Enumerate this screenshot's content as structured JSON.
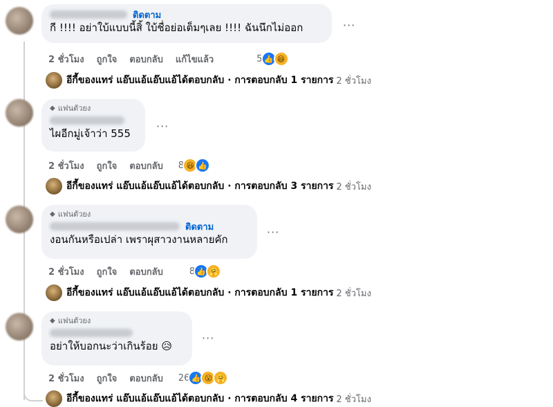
{
  "comments": [
    {
      "badge": "",
      "follow": "ติดตาม",
      "text": "กี !!!! อย่าใบ้แบบนี้สิ้ ใบ้ชื่อย่อเต็มๆเลย !!!! ฉันนึกไม่ออก",
      "actions": {
        "time": "2 ชั่วโมง",
        "like": "ถูกใจ",
        "reply": "ตอบกลับ",
        "edited": "แก้ไขแล้ว"
      },
      "reaction_count": "5",
      "reply_summary": {
        "name": "อีกี้ของแทร่ แอ๊บแอ้แอ๊บแอ้",
        "text": " ได้ตอบกลับ · การตอบกลับ 1 รายการ",
        "time": "2 ชั่วโมง"
      }
    },
    {
      "badge": "แฟนตัวยง",
      "text": "ไผอีกมู่เจ้าว่า 555",
      "actions": {
        "time": "2 ชั่วโมง",
        "like": "ถูกใจ",
        "reply": "ตอบกลับ"
      },
      "reaction_count": "8",
      "reply_summary": {
        "name": "อีกี้ของแทร่ แอ๊บแอ้แอ๊บแอ้",
        "text": " ได้ตอบกลับ · การตอบกลับ 3 รายการ",
        "time": "2 ชั่วโมง"
      }
    },
    {
      "badge": "แฟนตัวยง",
      "follow": "ติดตาม",
      "text": "งอนกันหรือเปล่า เพราผุสาวงานหลายคัก",
      "actions": {
        "time": "2 ชั่วโมง",
        "like": "ถูกใจ",
        "reply": "ตอบกลับ"
      },
      "reaction_count": "8",
      "reply_summary": {
        "name": "อีกี้ของแทร่ แอ๊บแอ้แอ๊บแอ้",
        "text": " ได้ตอบกลับ · การตอบกลับ 1 รายการ",
        "time": "2 ชั่วโมง"
      }
    },
    {
      "badge": "แฟนตัวยง",
      "text": "อย่าให้บอกนะว่าเกินร้อย",
      "actions": {
        "time": "2 ชั่วโมง",
        "like": "ถูกใจ",
        "reply": "ตอบกลับ"
      },
      "reaction_count": "26",
      "reply_summary": {
        "name": "อีกี้ของแทร่ แอ๊บแอ้แอ๊บแอ้",
        "text": " ได้ตอบกลับ · การตอบกลับ 4 รายการ",
        "time": "2 ชั่วโมง"
      }
    }
  ],
  "icons": {
    "more": "more-options-icon",
    "badge": "diamond-icon"
  },
  "colors": {
    "follow": "#0064d1",
    "like": "#1877f2",
    "emoji": "#f7b125"
  }
}
